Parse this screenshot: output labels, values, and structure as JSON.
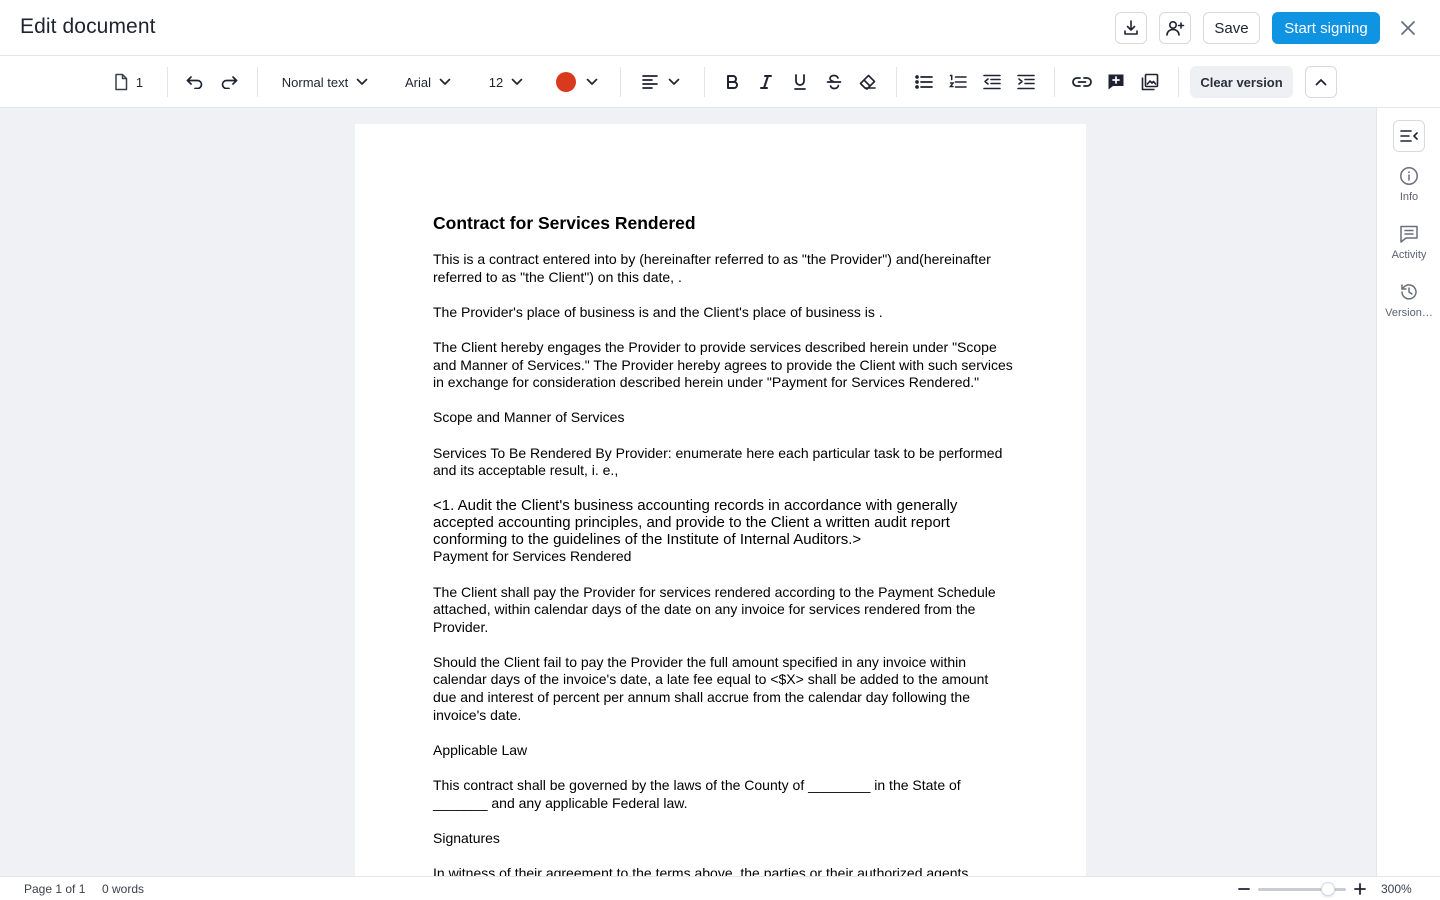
{
  "header": {
    "title": "Edit document",
    "save_label": "Save",
    "start_signing_label": "Start signing"
  },
  "toolbar": {
    "page_count": "1",
    "text_style": "Normal text",
    "font": "Arial",
    "font_size": "12",
    "text_color": "#d93a1e",
    "clear_version_label": "Clear version"
  },
  "document": {
    "title": "Contract for Services Rendered",
    "paragraphs": [
      "This is a contract entered into by (hereinafter referred to as \"the Provider\") and(hereinafter referred to as \"the Client\") on this date, .",
      "The Provider's place of business is and the Client's place of business is .",
      "The Client hereby engages the Provider to provide services described herein under \"Scope and Manner of Services.\" The Provider hereby agrees to provide the Client with such services in exchange for consideration described herein under \"Payment for Services Rendered.\"",
      "Scope and Manner of Services",
      "Services To Be Rendered By Provider: enumerate here each particular task to be performed and its acceptable result, i. e.,",
      "<1. Audit the Client's business accounting records in accordance with generally accepted accounting principles, and provide to the Client a written audit report conforming to the guidelines of the Institute of Internal Auditors.>",
      "Payment for Services Rendered",
      "The Client shall pay the Provider for services rendered according to the Payment Schedule attached, within calendar days of the date on any invoice for services rendered from the Provider.",
      "Should the Client fail to pay the Provider the full amount specified in any invoice within calendar days of the invoice's date, a late fee equal to <$X> shall be added to the amount due and interest of percent per annum shall accrue from the calendar day following the invoice's date.",
      "Applicable Law",
      "This contract shall be governed by the laws of the County of ________ in the State of _______ and any applicable Federal law.",
      "Signatures",
      "In witness of their agreement to the terms above, the parties or their authorized agents hereby affix their signatures:"
    ]
  },
  "sidebar": {
    "items": [
      {
        "label": "Info",
        "icon": "info-icon"
      },
      {
        "label": "Activity",
        "icon": "comment-icon"
      },
      {
        "label": "Version…",
        "icon": "history-icon"
      }
    ]
  },
  "status": {
    "page_label": "Page 1 of 1",
    "words_label": "0 words",
    "zoom_label": "300%",
    "zoom_fraction": 0.8
  }
}
